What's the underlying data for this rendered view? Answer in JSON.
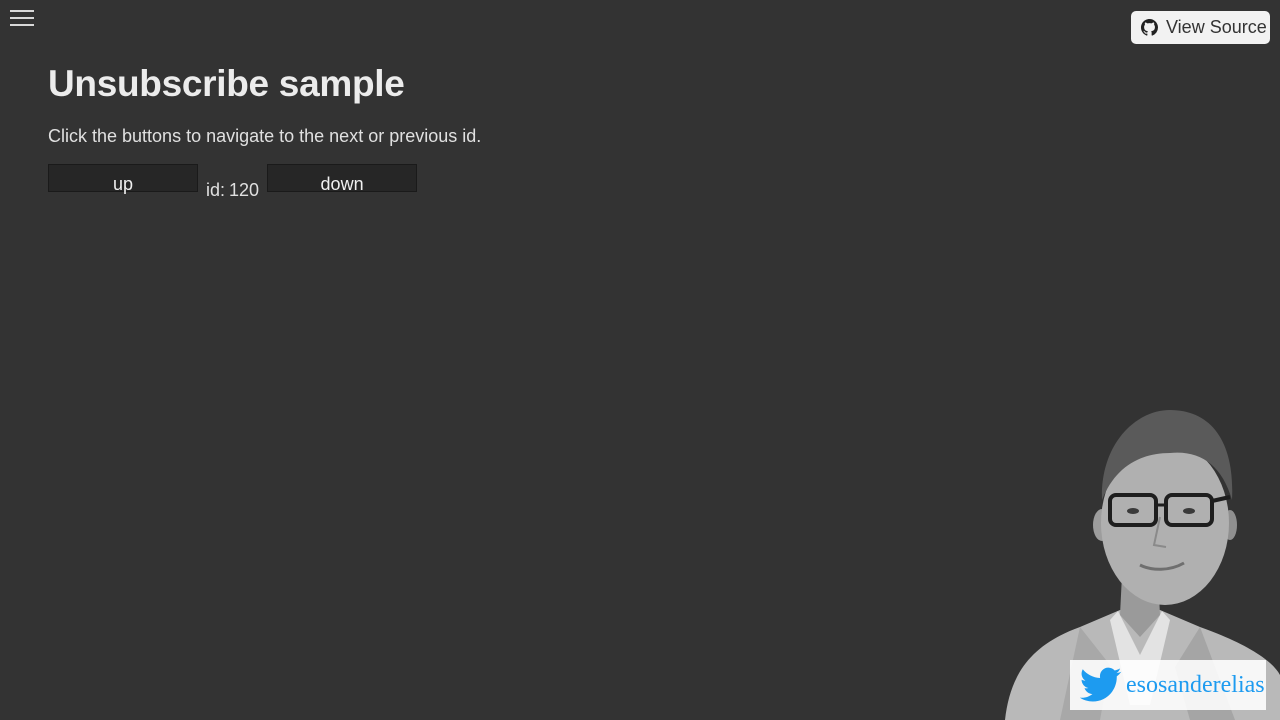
{
  "header": {
    "menu_icon": "hamburger-menu-icon",
    "view_source": {
      "label": "View Source",
      "icon": "github-icon"
    }
  },
  "main": {
    "title": "Unsubscribe sample",
    "description": "Click the buttons to navigate to the next or previous id.",
    "up_label": "up",
    "id_label": "id:",
    "id_value": "120",
    "down_label": "down"
  },
  "badge": {
    "icon": "twitter-bird-icon",
    "handle": "esosanderelias",
    "color": "#1d9bf0"
  }
}
